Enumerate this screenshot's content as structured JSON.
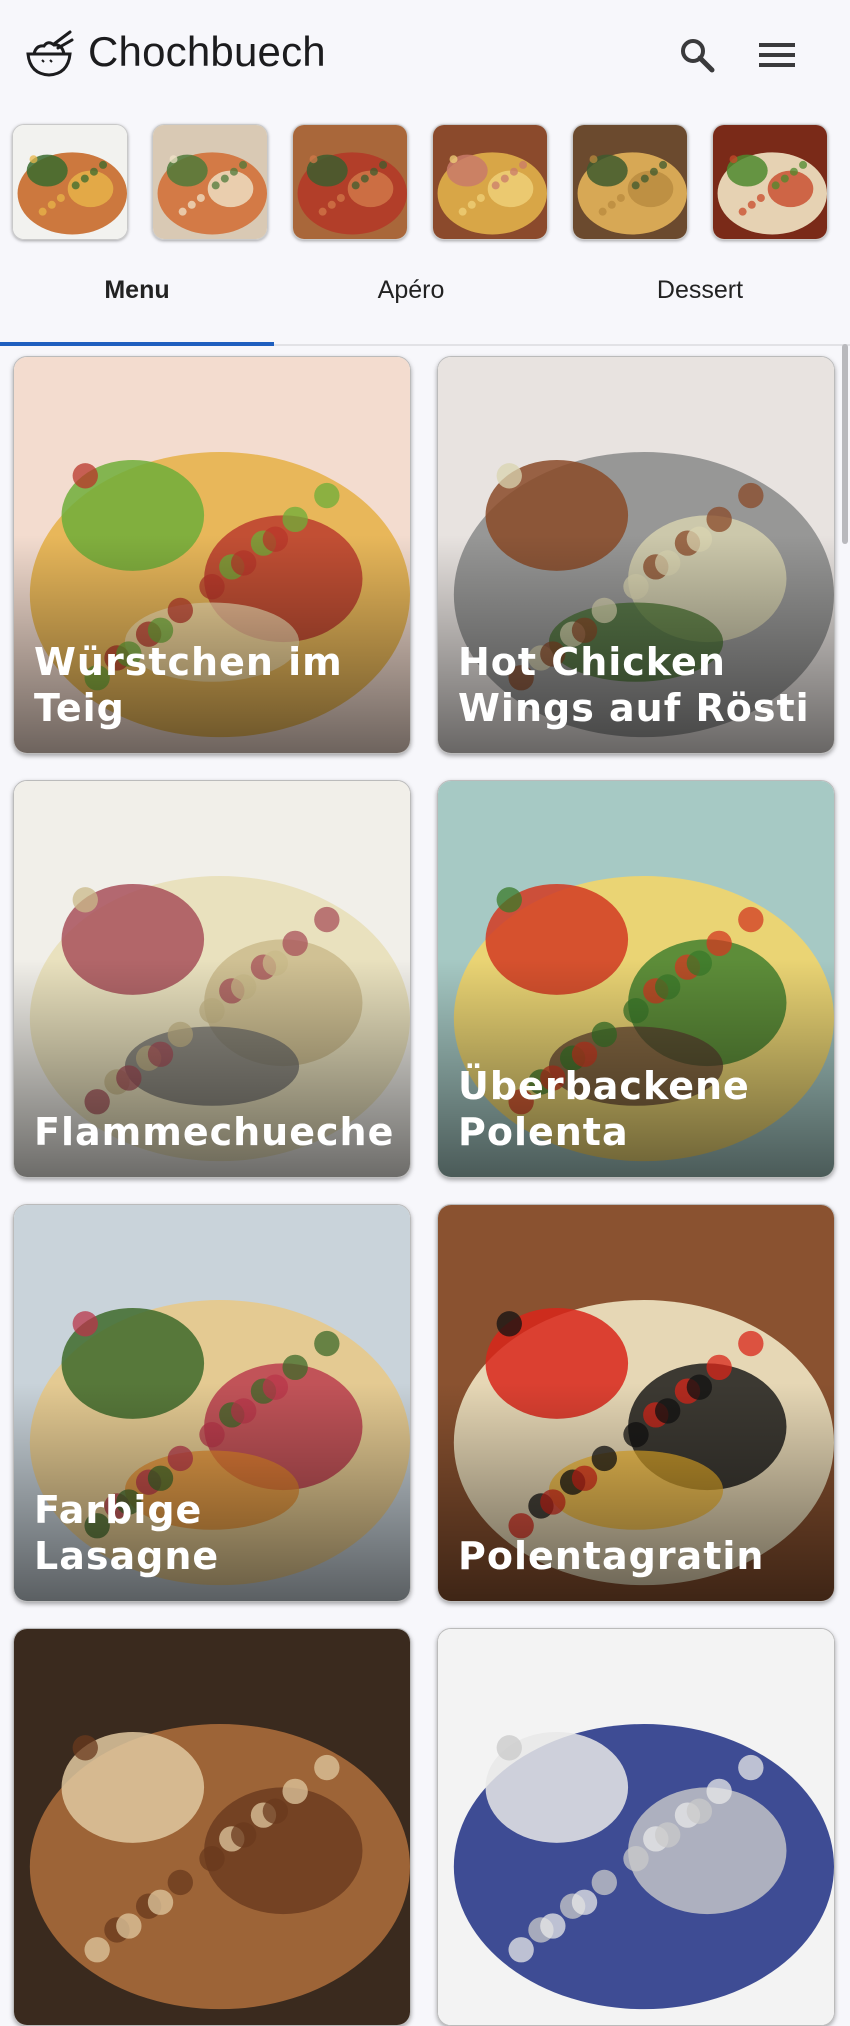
{
  "app": {
    "title": "Chochbuech",
    "logo_icon": "bowl-with-chopsticks-icon",
    "search_icon": "search-icon",
    "menu_icon": "hamburger-menu-icon"
  },
  "carousel": {
    "items": [
      {
        "name": "carousel-thumb-1",
        "colors": [
          "#f2f2ef",
          "#c86a2a",
          "#3a6b2e",
          "#e8b54a"
        ]
      },
      {
        "name": "carousel-thumb-2",
        "colors": [
          "#d9c9b4",
          "#d2713a",
          "#4f7a3a",
          "#f0e3c8"
        ]
      },
      {
        "name": "carousel-thumb-3",
        "colors": [
          "#a9673a",
          "#b23a28",
          "#3d5d2e",
          "#d27a4a"
        ]
      },
      {
        "name": "carousel-thumb-4",
        "colors": [
          "#8b4a2c",
          "#e0b04a",
          "#c97a6a",
          "#f0d27a"
        ]
      },
      {
        "name": "carousel-thumb-5",
        "colors": [
          "#6b4a2e",
          "#e3b25a",
          "#3e5a2e",
          "#b88a3e"
        ]
      },
      {
        "name": "carousel-thumb-6",
        "colors": [
          "#7a2a18",
          "#f2e4c4",
          "#4e8a2e",
          "#c84a2a"
        ]
      }
    ]
  },
  "tabs": [
    {
      "label": "Menu",
      "active": true
    },
    {
      "label": "Apéro",
      "active": false
    },
    {
      "label": "Dessert",
      "active": false
    }
  ],
  "recipes": [
    {
      "title": "Würstchen im Teig",
      "colors": [
        "#f3dccf",
        "#e7b24c",
        "#6eae3a",
        "#b8352a",
        "#f6e3b6"
      ]
    },
    {
      "title": "Hot Chicken Wings auf Rösti",
      "colors": [
        "#e8e3e0",
        "#8e8e8e",
        "#8a4a28",
        "#d9d4b0",
        "#3e6b28"
      ]
    },
    {
      "title": "Flammechueche",
      "colors": [
        "#f1efe9",
        "#e8dfb9",
        "#a8505a",
        "#c9b98a",
        "#6a6a6a"
      ]
    },
    {
      "title": "Überbackene Polenta",
      "colors": [
        "#a6c9c4",
        "#f2d56b",
        "#d23a22",
        "#3a7a2a",
        "#5a3a2e"
      ]
    },
    {
      "title": "Farbige Lasagne",
      "colors": [
        "#c9d3da",
        "#e7c98a",
        "#3e6a2a",
        "#b8354a",
        "#e58a2a"
      ]
    },
    {
      "title": "Polentagratin",
      "colors": [
        "#8a5230",
        "#f0e6c4",
        "#d8261a",
        "#111111",
        "#f2b52a"
      ]
    }
  ]
}
